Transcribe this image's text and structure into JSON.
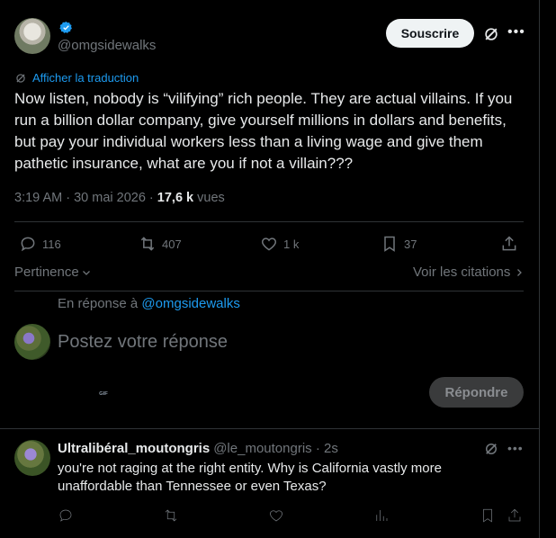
{
  "tweet": {
    "handle": "@omgsidewalks",
    "subscribe_label": "Souscrire",
    "translate_label": "Afficher la traduction",
    "text": "Now listen, nobody is “vilifying” rich people. They are actual villains. If you run a billion dollar company, give yourself millions in dollars and benefits, but pay your individual workers less than a living wage and give them pathetic insurance, what are you if not a villain???",
    "time": "3:19 AM · 30 mai 2026 · ",
    "views_count": "17,6 k",
    "views_label": " vues",
    "replies": "116",
    "reposts": "407",
    "likes": "1 k",
    "bookmarks": "37",
    "accent_color": "#1d9bf0"
  },
  "sort": {
    "label": "Pertinence",
    "quotes_label": "Voir les citations"
  },
  "compose": {
    "replying_prefix": "En réponse à ",
    "replying_handle": "@omgsidewalks",
    "placeholder": "Postez votre réponse",
    "reply_button": "Répondre"
  },
  "reply": {
    "name": "Ultralibéral_moutongris",
    "handle_time": "@le_moutongris · 2s",
    "text": "you're not raging at the right entity. Why is California vastly more unaffordable than Tennessee or even Texas?"
  }
}
